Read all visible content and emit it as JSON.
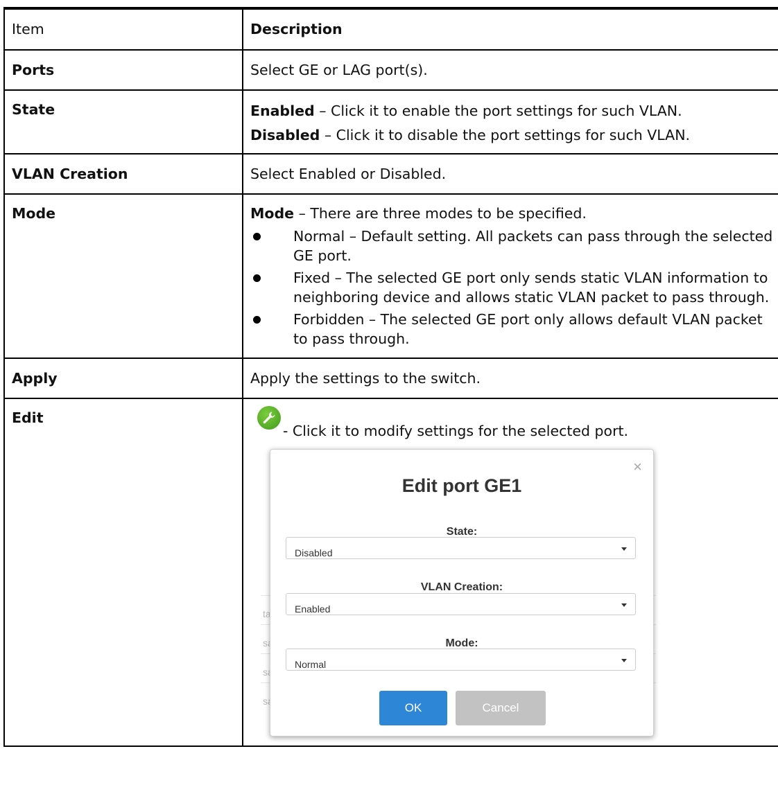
{
  "table": {
    "header": {
      "item": "Item",
      "description": "Description"
    },
    "ports": {
      "item": "Ports",
      "description": "Select GE or LAG port(s)."
    },
    "state": {
      "item": "State",
      "enabled_term": "Enabled",
      "enabled_text": " – Click it to enable the port settings for such VLAN.",
      "disabled_term": "Disabled",
      "disabled_text": " – Click it to disable the port settings for such VLAN."
    },
    "vlan_creation": {
      "item": "VLAN Creation",
      "description": "Select Enabled or Disabled."
    },
    "mode": {
      "item": "Mode",
      "intro_term": "Mode",
      "intro_text": " – There are three modes to be specified.",
      "bullets": [
        "Normal – Default setting. All packets can pass through the selected GE port.",
        "Fixed – The selected GE port only sends static VLAN information to neighboring device and allows static VLAN packet to pass through.",
        "Forbidden – The selected GE port only allows default VLAN packet to pass through."
      ]
    },
    "apply": {
      "item": "Apply",
      "description": "Apply the settings to the switch."
    },
    "edit": {
      "item": "Edit",
      "description": " - Click it to modify settings for the selected port."
    }
  },
  "dialog": {
    "title": "Edit port GE1",
    "close_glyph": "×",
    "state_label": "State:",
    "state_value": "Disabled",
    "vlan_label": "VLAN Creation:",
    "vlan_value": "Enabled",
    "mode_label": "Mode:",
    "mode_value": "Normal",
    "ok": "OK",
    "cancel": "Cancel",
    "background_fragments": [
      "tat",
      "sa",
      "sa",
      "sa"
    ]
  },
  "icons": {
    "edit": "wrench-icon"
  },
  "colors": {
    "ok_button": "#2e86d6",
    "cancel_button": "#c2c2c2",
    "wrench_green": "#4ca524"
  }
}
